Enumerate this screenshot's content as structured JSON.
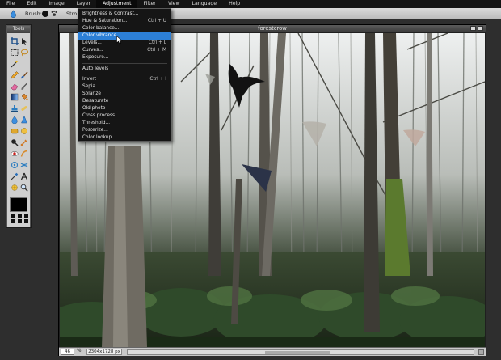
{
  "menubar": {
    "items": [
      "File",
      "Edit",
      "Image",
      "Layer",
      "Adjustment",
      "Filter",
      "View",
      "Language",
      "Help"
    ],
    "active_index": 4
  },
  "options_bar": {
    "brush_label": "Brush:",
    "stroke_label": "Stro"
  },
  "tools": {
    "title": "Tools",
    "icons": [
      "crop-icon",
      "move-icon",
      "marquee-select-icon",
      "lasso-icon",
      "magic-wand-icon",
      "empty-slot",
      "pencil-icon",
      "brush-icon",
      "eraser-icon",
      "color-replace-icon",
      "gradient-icon",
      "paint-bucket-icon",
      "clone-stamp-icon",
      "heal-icon",
      "blur-icon",
      "sharpen-icon",
      "sponge-icon",
      "dodge-icon",
      "burn-icon",
      "smudge-icon",
      "red-eye-icon",
      "drawing-icon",
      "bloat-icon",
      "pinch-icon",
      "color-picker-icon",
      "type-icon",
      "hand-icon",
      "zoom-icon"
    ],
    "primary_color": "#000000"
  },
  "document": {
    "title": "forestcrow",
    "zoom": "46",
    "zoom_unit": "%",
    "size": "2304x1728 px"
  },
  "adjustment_menu": {
    "items": [
      {
        "label": "Brightness & Contrast...",
        "shortcut": ""
      },
      {
        "label": "Hue & Saturation...",
        "shortcut": "Ctrl + U"
      },
      {
        "label": "Color balance...",
        "shortcut": ""
      },
      {
        "label": "Color vibrance...",
        "shortcut": "",
        "highlighted": true
      },
      {
        "label": "Levels...",
        "shortcut": "Ctrl + L"
      },
      {
        "label": "Curves...",
        "shortcut": "Ctrl + M"
      },
      {
        "label": "Exposure...",
        "shortcut": ""
      },
      {
        "label": "Auto levels",
        "shortcut": ""
      },
      {
        "label": "Invert",
        "shortcut": "Ctrl + I"
      },
      {
        "label": "Sepia",
        "shortcut": ""
      },
      {
        "label": "Solarize",
        "shortcut": ""
      },
      {
        "label": "Desaturate",
        "shortcut": ""
      },
      {
        "label": "Old photo",
        "shortcut": ""
      },
      {
        "label": "Cross process",
        "shortcut": ""
      },
      {
        "label": "Threshold...",
        "shortcut": ""
      },
      {
        "label": "Posterize...",
        "shortcut": ""
      },
      {
        "label": "Color lookup...",
        "shortcut": ""
      }
    ]
  },
  "colors": {
    "menu_highlight": "#2c7fd6",
    "menubar_bg": "#141414",
    "panel_bg": "#cfcfcf"
  }
}
